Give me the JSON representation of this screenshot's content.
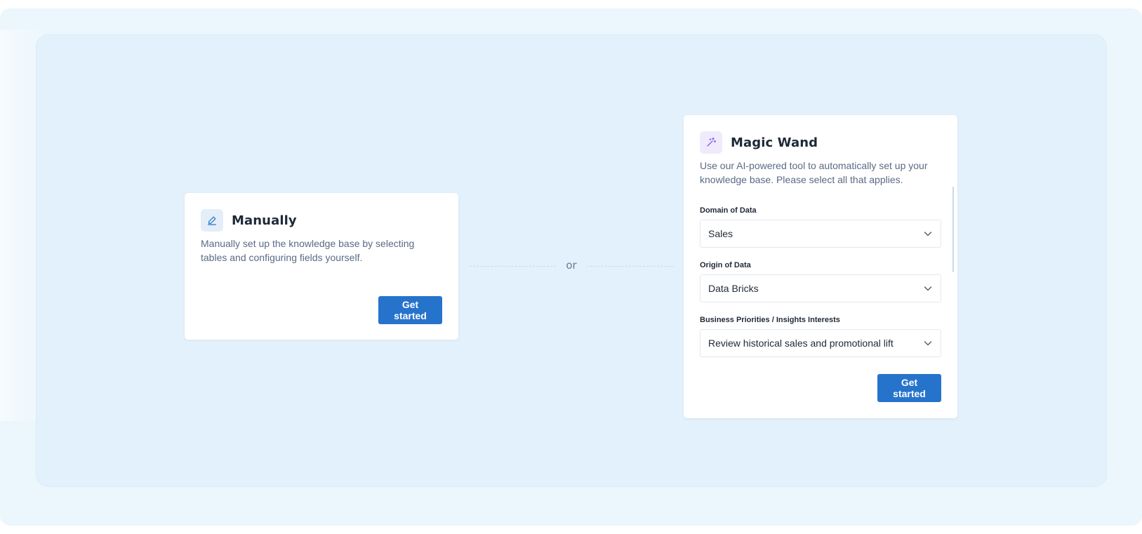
{
  "manual_card": {
    "title": "Manually",
    "icon": "pencil-icon",
    "description": "Manually set up the knowledge base by selecting tables and configuring fields yourself.",
    "button_label": "Get started"
  },
  "separator": {
    "label": "or"
  },
  "magic_card": {
    "title": "Magic Wand",
    "icon": "magic-wand-icon",
    "description": "Use our AI-powered tool to automatically set up your knowledge base.  Please select all that applies.",
    "fields": [
      {
        "label": "Domain of Data",
        "value": "Sales"
      },
      {
        "label": "Origin of Data",
        "value": "Data Bricks"
      },
      {
        "label": "Business Priorities / Insights Interests",
        "value": "Review historical sales and promotional lift"
      }
    ],
    "button_label": "Get started"
  },
  "colors": {
    "accent": "#2673cc",
    "page_bg": "#ebf6fd",
    "panel_bg": "#e2f1fb",
    "magic_icon": "#8b5cf6",
    "manual_icon": "#2673cc"
  }
}
